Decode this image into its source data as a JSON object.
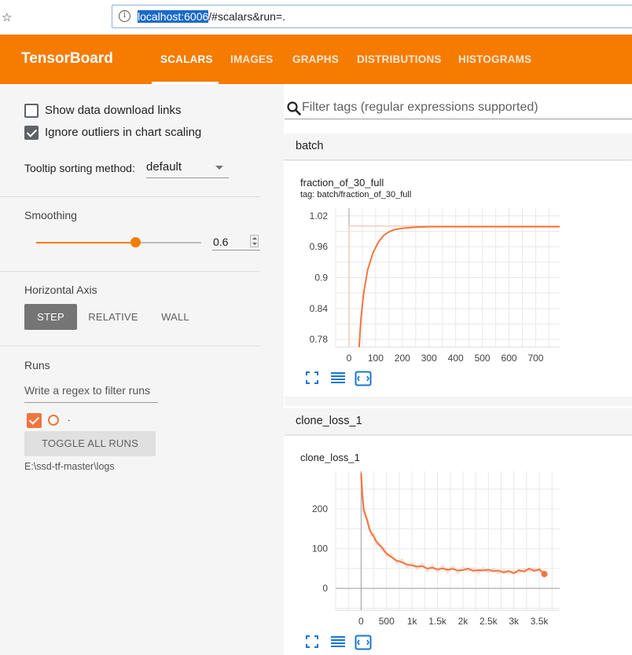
{
  "browser": {
    "url_host": "localhost:6006",
    "url_rest": "/#scalars&run=."
  },
  "app": {
    "brand": "TensorBoard",
    "tabs": [
      {
        "label": "SCALARS",
        "active": true
      },
      {
        "label": "IMAGES",
        "active": false
      },
      {
        "label": "GRAPHS",
        "active": false
      },
      {
        "label": "DISTRIBUTIONS",
        "active": false
      },
      {
        "label": "HISTOGRAMS",
        "active": false
      }
    ],
    "accent_color": "#f57c00"
  },
  "sidebar": {
    "show_download_links": {
      "label": "Show data download links",
      "checked": false
    },
    "ignore_outliers": {
      "label": "Ignore outliers in chart scaling",
      "checked": true
    },
    "tooltip_sorting": {
      "label": "Tooltip sorting method:",
      "value": "default"
    },
    "smoothing": {
      "title": "Smoothing",
      "value": "0.6",
      "fraction": 0.6
    },
    "horizontal_axis": {
      "title": "Horizontal Axis",
      "options": [
        "STEP",
        "RELATIVE",
        "WALL"
      ],
      "selected": "STEP"
    },
    "runs": {
      "title": "Runs",
      "filter_placeholder": "Write a regex to filter runs",
      "items": [
        {
          "name": ".",
          "checked": true,
          "color": "#f0753f"
        }
      ],
      "toggle_label": "TOGGLE ALL RUNS",
      "logdir": "E:\\ssd-tf-master\\logs"
    }
  },
  "main": {
    "search_placeholder": "Filter tags (regular expressions supported)",
    "groups": [
      {
        "name": "batch",
        "card": {
          "title": "fraction_of_30_full",
          "tag": "tag: batch/fraction_of_30_full"
        }
      },
      {
        "name": "clone_loss_1",
        "card": {
          "title": "clone_loss_1"
        }
      }
    ]
  },
  "chart_data": [
    {
      "type": "line",
      "title": "fraction_of_30_full",
      "x_ticks": [
        "0",
        "100",
        "200",
        "300",
        "400",
        "500",
        "600",
        "700"
      ],
      "y_ticks": [
        "0.78",
        "0.84",
        "0.9",
        "0.96",
        "1.02"
      ],
      "xlim": [
        -50,
        790
      ],
      "ylim": [
        0.765,
        1.035
      ],
      "series": [
        {
          "color": "#f0753f",
          "x": [
            38,
            45,
            55,
            70,
            90,
            110,
            130,
            150,
            170,
            200,
            250,
            300,
            400,
            500,
            600,
            700,
            790
          ],
          "y": [
            0.765,
            0.82,
            0.87,
            0.915,
            0.948,
            0.969,
            0.982,
            0.989,
            0.993,
            0.996,
            0.998,
            0.999,
            0.999,
            0.999,
            0.999,
            0.999,
            0.999
          ]
        }
      ],
      "raw_series": [
        {
          "x": [
            0,
            0,
            15,
            790
          ],
          "y": [
            0.765,
            1.0,
            1.0,
            1.0
          ]
        }
      ]
    },
    {
      "type": "line",
      "title": "clone_loss_1",
      "x_ticks": [
        "0",
        "500",
        "1k",
        "1.5k",
        "2k",
        "2.5k",
        "3k",
        "3.5k"
      ],
      "x_tick_values": [
        0,
        500,
        1000,
        1500,
        2000,
        2500,
        3000,
        3500
      ],
      "y_ticks": [
        "0",
        "100",
        "200"
      ],
      "xlim": [
        -500,
        3900
      ],
      "ylim": [
        -55,
        295
      ],
      "series": [
        {
          "color": "#f0753f",
          "x": [
            0,
            20,
            50,
            80,
            120,
            160,
            200,
            250,
            300,
            350,
            400,
            450,
            500,
            600,
            700,
            800,
            900,
            1000,
            1100,
            1200,
            1300,
            1400,
            1500,
            1600,
            1700,
            1800,
            1900,
            2000,
            2100,
            2200,
            2300,
            2400,
            2500,
            2600,
            2700,
            2800,
            2900,
            3000,
            3100,
            3200,
            3300,
            3400,
            3500,
            3600
          ],
          "y": [
            290,
            240,
            200,
            185,
            172,
            150,
            140,
            130,
            118,
            110,
            105,
            95,
            88,
            78,
            70,
            66,
            60,
            58,
            55,
            56,
            50,
            52,
            48,
            50,
            47,
            49,
            45,
            46,
            50,
            44,
            46,
            45,
            47,
            43,
            45,
            40,
            44,
            38,
            46,
            42,
            50,
            44,
            48,
            36
          ]
        }
      ]
    }
  ]
}
